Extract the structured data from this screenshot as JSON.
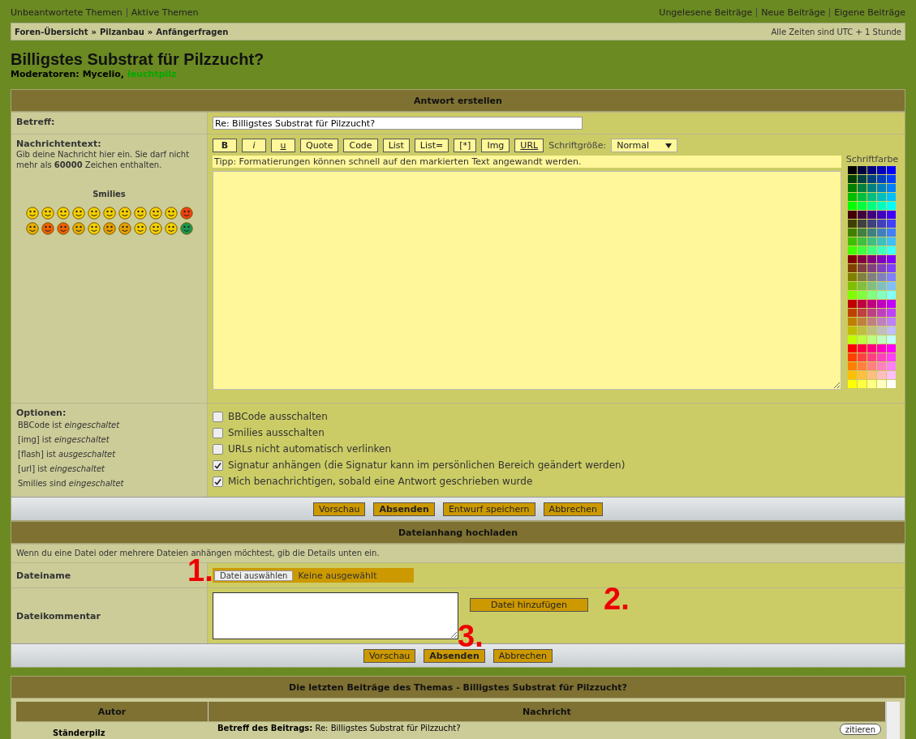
{
  "top_links_left": [
    "Unbeantwortete Themen",
    "Aktive Themen"
  ],
  "top_links_right": [
    "Ungelesene Beiträge",
    "Neue Beiträge",
    "Eigene Beiträge"
  ],
  "breadcrumb": [
    "Foren-Übersicht",
    "Pilzanbau",
    "Anfängerfragen"
  ],
  "breadcrumb_separator": "»",
  "timezone": "Alle Zeiten sind UTC + 1 Stunde",
  "topic_title": "Billigstes Substrat für Pilzzucht?",
  "moderators": {
    "label": "Moderatoren:",
    "names": [
      {
        "name": "Mycelio,",
        "color": "#000000"
      },
      {
        "name": "leuchtpilz",
        "color": "#00aa00"
      }
    ]
  },
  "reply_panel": {
    "title": "Antwort erstellen",
    "subject": {
      "label": "Betreff:",
      "value": "Re: Billigstes Substrat für Pilzzucht?"
    },
    "message": {
      "label": "Nachrichtentext:",
      "hint": "Gib deine Nachricht hier ein. Sie darf nicht mehr als **60000** Zeichen enthalten.",
      "smilies_title": "Smilies",
      "format_buttons": [
        "B",
        "i",
        "u",
        "Quote",
        "Code",
        "List",
        "List=",
        "[*]",
        "Img",
        "URL"
      ],
      "font_size_label": "Schriftgröße:",
      "font_size": "Normal",
      "tip": "Tipp: Formatierungen können schnell auf den markierten Text angewandt werden.",
      "color_label": "Schriftfarbe"
    },
    "options": {
      "label": "Optionen:",
      "status": [
        "BBCode ist *eingeschaltet*",
        "[img] ist *eingeschaltet*",
        "[flash] ist *ausgeschaltet*",
        "[url] ist *eingeschaltet*",
        "Smilies sind *eingeschaltet*"
      ],
      "checkboxes": [
        {
          "label": "BBCode ausschalten",
          "checked": false
        },
        {
          "label": "Smilies ausschalten",
          "checked": false
        },
        {
          "label": "URLs nicht automatisch verlinken",
          "checked": false
        },
        {
          "label": "Signatur anhängen (die Signatur kann im persönlichen Bereich geändert werden)",
          "checked": true
        },
        {
          "label": "Mich benachrichtigen, sobald eine Antwort geschrieben wurde",
          "checked": true
        }
      ]
    },
    "buttons": [
      {
        "label": "Vorschau",
        "primary": false
      },
      {
        "label": "Absenden",
        "primary": true
      },
      {
        "label": "Entwurf speichern",
        "primary": false
      },
      {
        "label": "Abbrechen",
        "primary": false
      }
    ]
  },
  "attachment_panel": {
    "title": "Dateianhang hochladen",
    "info": "Wenn du eine Datei oder mehrere Dateien anhängen möchtest, gib die Details unten ein.",
    "filename_label": "Dateiname",
    "choose_button": "Datei auswählen",
    "no_file": "Keine ausgewählt",
    "comment_label": "Dateikommentar",
    "add_button": "Datei hinzufügen",
    "buttons": [
      {
        "label": "Vorschau",
        "primary": false
      },
      {
        "label": "Absenden",
        "primary": true
      },
      {
        "label": "Abbrechen",
        "primary": false
      }
    ],
    "annotations": [
      "1.",
      "2.",
      "3."
    ]
  },
  "recent_panel": {
    "title": "Die letzten Beiträge des Themas - Billigstes Substrat für Pilzzucht?",
    "columns": [
      "Autor",
      "Nachricht"
    ],
    "rows": [
      {
        "author": "Ständerpilz",
        "subject_label": "Betreff des Beitrags:",
        "subject": "Re: Billigstes Substrat für Pilzzucht?",
        "quote_button": "zitieren"
      }
    ]
  }
}
